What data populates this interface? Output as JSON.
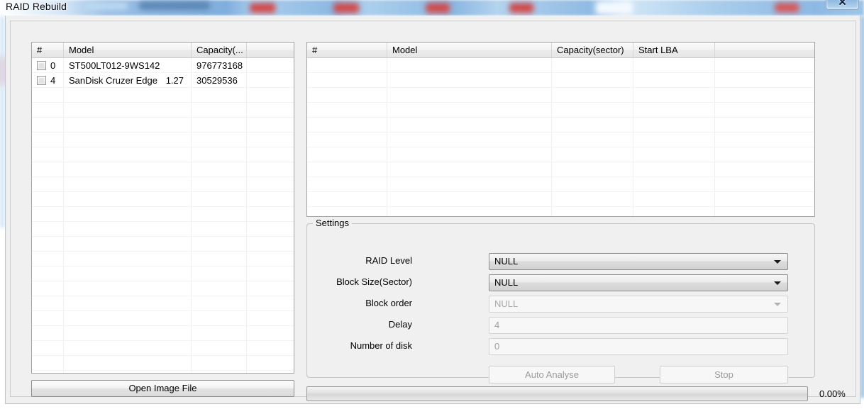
{
  "window": {
    "title": "RAID Rebuild",
    "close_label": "✕"
  },
  "left_panel": {
    "table": {
      "headers": [
        "#",
        "Model",
        "Capacity(...",
        ""
      ],
      "rows": [
        {
          "index": "0",
          "model": "ST500LT012-9WS142",
          "version": "",
          "capacity": "976773168",
          "extra": ""
        },
        {
          "index": "4",
          "model": "SanDisk Cruzer Edge",
          "version": "1.27",
          "capacity": "30529536",
          "extra": ""
        }
      ],
      "empty_row_count": 20
    },
    "open_image_file_label": "Open Image File"
  },
  "right_panel": {
    "table": {
      "headers": [
        "#",
        "Model",
        "Capacity(sector)",
        "Start LBA",
        ""
      ],
      "rows": [],
      "empty_row_count": 11
    }
  },
  "settings": {
    "legend": "Settings",
    "fields": [
      {
        "label": "RAID Level",
        "type": "combo",
        "value": "NULL",
        "disabled": false
      },
      {
        "label": "Block Size(Sector)",
        "type": "combo",
        "value": "NULL",
        "disabled": false
      },
      {
        "label": "Block order",
        "type": "combo",
        "value": "NULL",
        "disabled": true
      },
      {
        "label": "Delay",
        "type": "textbox",
        "value": "4",
        "disabled": true
      },
      {
        "label": "Number of disk",
        "type": "textbox",
        "value": "0",
        "disabled": true
      }
    ],
    "auto_analyse_label": "Auto Analyse",
    "stop_label": "Stop"
  },
  "progress": {
    "percent_label": "0.00%",
    "value": 0
  }
}
